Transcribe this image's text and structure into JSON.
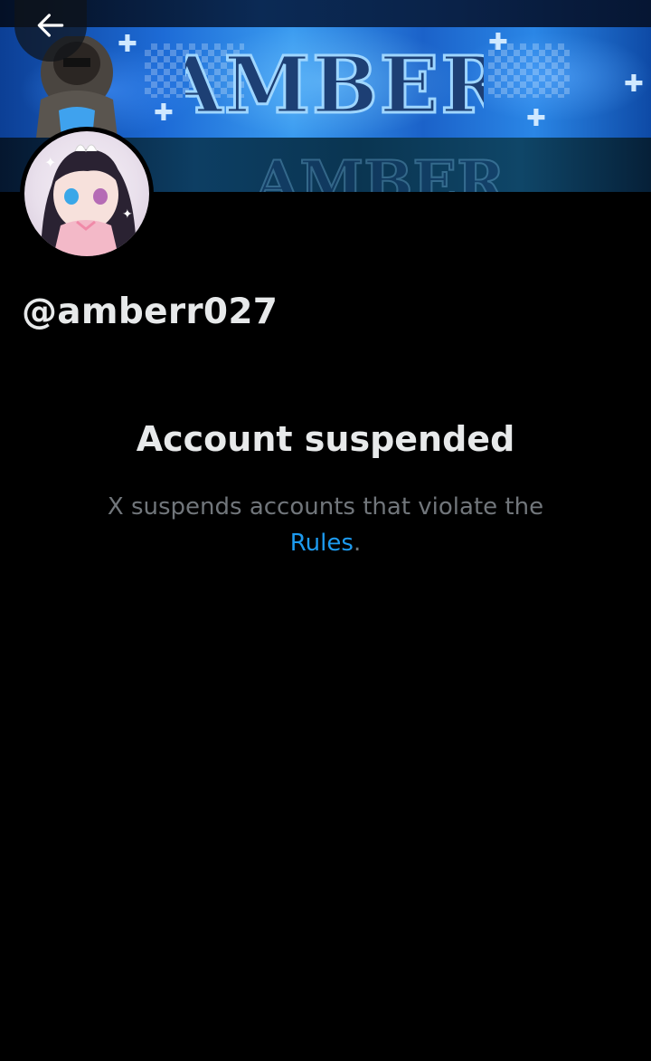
{
  "header": {
    "back_icon": "arrow-left-icon",
    "banner_word": "AMBER"
  },
  "profile": {
    "handle": "@amberr027"
  },
  "notice": {
    "title": "Account suspended",
    "body_prefix": "X suspends accounts that violate the",
    "link_label": "Rules",
    "body_suffix": "."
  },
  "colors": {
    "background": "#000000",
    "primary_text": "#e7e9ea",
    "secondary_text": "#71767b",
    "link": "#1d9bf0"
  }
}
